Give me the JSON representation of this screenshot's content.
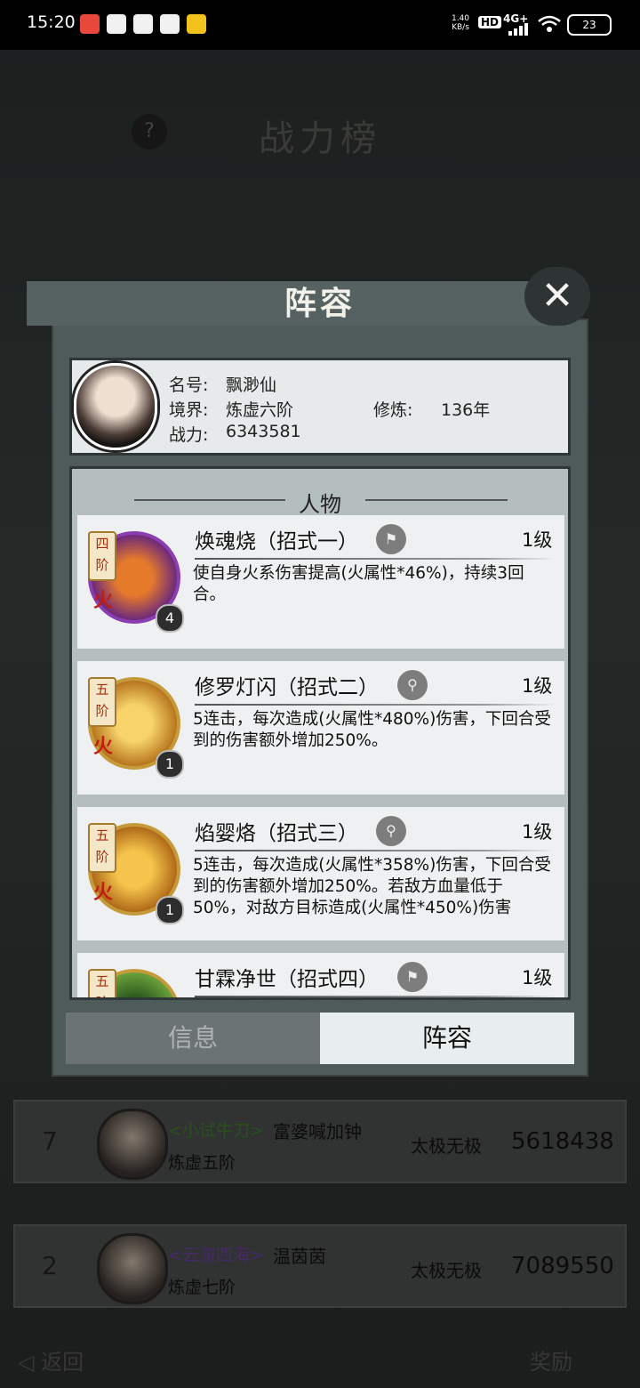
{
  "status_bar": {
    "time": "15:20",
    "net_speed": "1.40 KB/s",
    "hd": "HD",
    "network": "4G+",
    "battery": "23",
    "icons": [
      "app-icon-red",
      "mail-icon",
      "game-icon",
      "app-icon-square",
      "app-icon-blue"
    ]
  },
  "background": {
    "title": "战力榜",
    "help": "?",
    "rows": [
      {
        "rank": "7",
        "sect": "<小试牛刀>",
        "sect_color": "#3f7a2e",
        "name": "富婆喊加钟",
        "realm": "炼虚五阶",
        "faction": "太极无极",
        "power": "5618438"
      },
      {
        "rank": "2",
        "sect": "<云游四海>",
        "sect_color": "#6a3fa0",
        "name": "温茵茵",
        "realm": "炼虚七阶",
        "faction": "太极无极",
        "power": "7089550"
      }
    ],
    "back_label": "返回",
    "reward_label": "奖励"
  },
  "modal": {
    "title": "阵容",
    "close": "✕",
    "profile": {
      "name_label": "名号:",
      "name": "飘渺仙",
      "realm_label": "境界:",
      "realm": "炼虚六阶",
      "cultivation_label": "修炼:",
      "cultivation": "136年",
      "power_label": "战力:",
      "power": "6343581"
    },
    "section_title": "人物",
    "skills": [
      {
        "tier": "四阶",
        "element": "火",
        "badge": "4",
        "name": "焕魂烧（招式一）",
        "level": "1级",
        "desc": "使自身火系伤害提高(火属性*46%)，持续3回合。",
        "ring": "#8a3fb0"
      },
      {
        "tier": "五阶",
        "element": "火",
        "badge": "1",
        "name": "修罗灯闪（招式二）",
        "level": "1级",
        "desc": "5连击，每次造成(火属性*480%)伤害，下回合受到的伤害额外增加250%。",
        "ring": "#c99a2e"
      },
      {
        "tier": "五阶",
        "element": "火",
        "badge": "1",
        "name": "焰婴烙（招式三）",
        "level": "1级",
        "desc": "5连击，每次造成(火属性*358%)伤害，下回合受到的伤害额外增加250%。若敌方血量低于50%，对敌方目标造成(火属性*450%)伤害",
        "ring": "#c99a2e"
      },
      {
        "tier": "五阶",
        "element": "",
        "badge": "",
        "name": "甘霖净世（招式四）",
        "level": "1级",
        "desc": "",
        "ring": "#c99a2e"
      }
    ],
    "tabs": [
      {
        "label": "信息",
        "active": false
      },
      {
        "label": "阵容",
        "active": true
      }
    ]
  }
}
